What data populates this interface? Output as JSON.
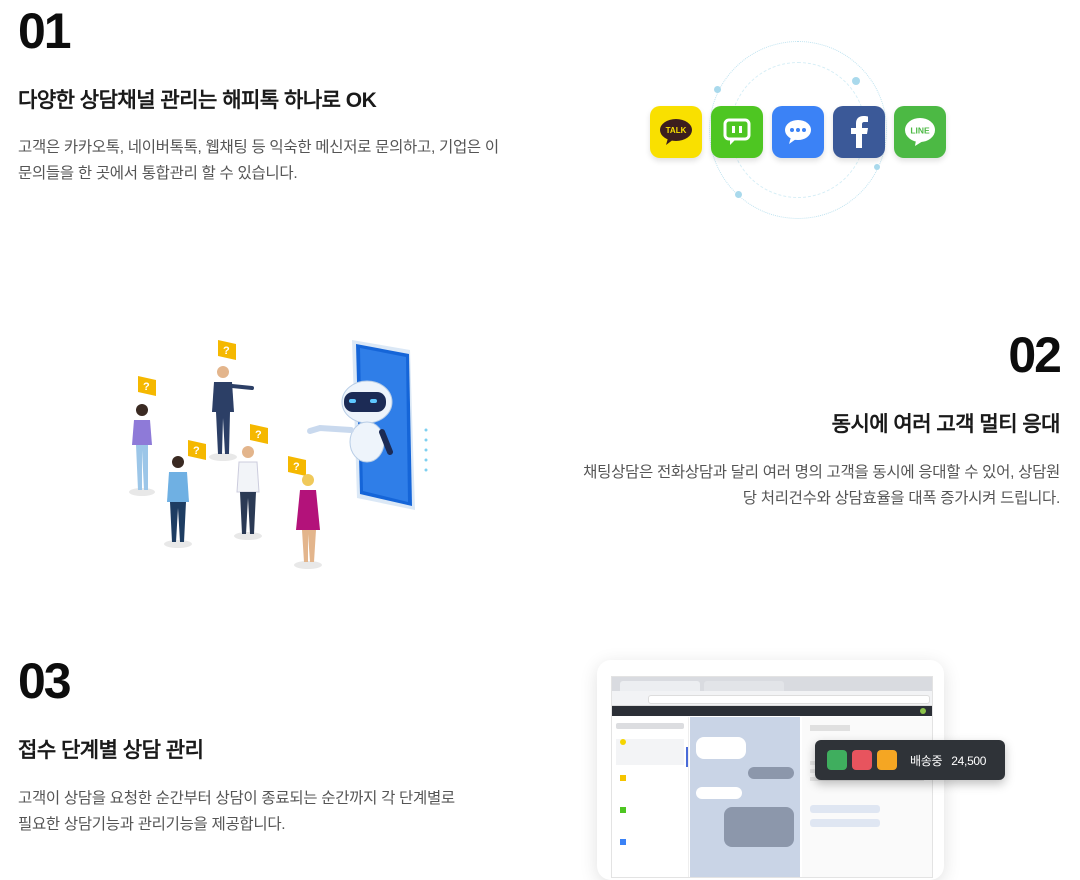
{
  "section1": {
    "number": "01",
    "title": "다양한 상담채널 관리는 해피톡 하나로 OK",
    "desc_line1": "고객은 카카오톡, 네이버톡톡, 웹채팅 등 익숙한 메신저로 문의하고, 기업은 이",
    "desc_line2": "문의들을 한 곳에서 통합관리 할 수 있습니다.",
    "channel_icons": [
      {
        "name": "kakaotalk-icon",
        "label": "TALK",
        "color": "#f9e000"
      },
      {
        "name": "naver-talktalk-icon",
        "color": "#4ec622"
      },
      {
        "name": "webchat-icon",
        "color": "#3b82f6"
      },
      {
        "name": "facebook-icon",
        "label": "f",
        "color": "#3b5998"
      },
      {
        "name": "line-icon",
        "label": "LINE",
        "color": "#4cb944"
      }
    ]
  },
  "section2": {
    "number": "02",
    "title": "동시에 여러 고객 멀티 응대",
    "desc_line1": "채팅상담은 전화상담과 달리 여러 명의 고객을 동시에 응대할 수 있어, 상담원",
    "desc_line2": "당 처리건수와 상담효율을 대폭 증가시켜 드립니다."
  },
  "section3": {
    "number": "03",
    "title": "접수 단계별 상담 관리",
    "desc_line1": "고객이 상담을 요청한 순간부터 상담이 종료되는 순간까지 각 단계별로",
    "desc_line2": "필요한 상담기능과 관리기능을 제공합니다.",
    "badge_status": "배송중",
    "badge_amount": "24,500"
  },
  "colors": {
    "heading": "#0d0d0d",
    "body_text": "#555555",
    "accent_blue": "#1565d8"
  }
}
